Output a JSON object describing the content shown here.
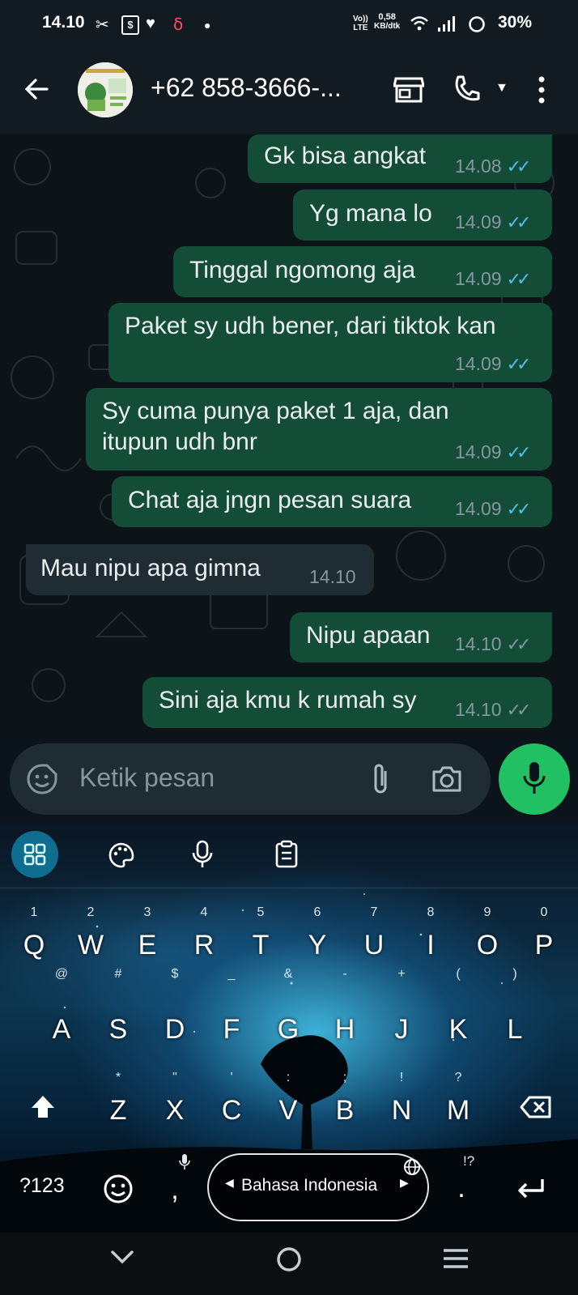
{
  "status_bar": {
    "time": "14.10",
    "net_top": "Vo))",
    "net_bottom": "LTE",
    "speed_value": "0,58",
    "speed_unit": "KB/dtk",
    "battery": "30%"
  },
  "header": {
    "contact": "+62 858-3666-..."
  },
  "messages": [
    {
      "dir": "out",
      "text": "Gk bisa angkat",
      "time": "14.08",
      "status": "read"
    },
    {
      "dir": "out",
      "text": "Yg mana lo",
      "time": "14.09",
      "status": "read"
    },
    {
      "dir": "out",
      "text": "Tinggal ngomong aja",
      "time": "14.09",
      "status": "read"
    },
    {
      "dir": "out",
      "text": "Paket sy udh bener, dari tiktok kan",
      "time": "14.09",
      "status": "read"
    },
    {
      "dir": "out",
      "line1": "Sy cuma punya paket 1 aja, dan",
      "line2": "itupun udh bnr",
      "time": "14.09",
      "status": "read"
    },
    {
      "dir": "out",
      "text": "Chat aja jngn pesan suara",
      "time": "14.09",
      "status": "read"
    },
    {
      "dir": "in",
      "text": "Mau nipu apa gimna",
      "time": "14.10"
    },
    {
      "dir": "out",
      "text": "Nipu apaan",
      "time": "14.10",
      "status": "delivered"
    },
    {
      "dir": "out",
      "text": "Sini aja kmu k rumah sy",
      "time": "14.10",
      "status": "delivered"
    }
  ],
  "composer": {
    "placeholder": "Ketik pesan"
  },
  "keyboard": {
    "row1": [
      "Q",
      "W",
      "E",
      "R",
      "T",
      "Y",
      "U",
      "I",
      "O",
      "P"
    ],
    "row1_hints": [
      "1",
      "2",
      "3",
      "4",
      "5",
      "6",
      "7",
      "8",
      "9",
      "0"
    ],
    "row2": [
      "A",
      "S",
      "D",
      "F",
      "G",
      "H",
      "J",
      "K",
      "L"
    ],
    "row2_hints": [
      "@",
      "#",
      "$",
      "_",
      "&",
      "-",
      "+",
      "(",
      ")"
    ],
    "row3": [
      "Z",
      "X",
      "C",
      "V",
      "B",
      "N",
      "M"
    ],
    "row3_hints": [
      "*",
      "\"",
      "'",
      ":",
      ";",
      "!",
      "?"
    ],
    "symbols_key": "?123",
    "comma": ",",
    "period": ".",
    "period_hint": "!?",
    "language": "Bahasa Indonesia"
  },
  "colors": {
    "outgoing_bubble": "#144d37",
    "incoming_bubble": "#1f2c33",
    "read_tick": "#53bdeb",
    "mic_button": "#21c063"
  }
}
